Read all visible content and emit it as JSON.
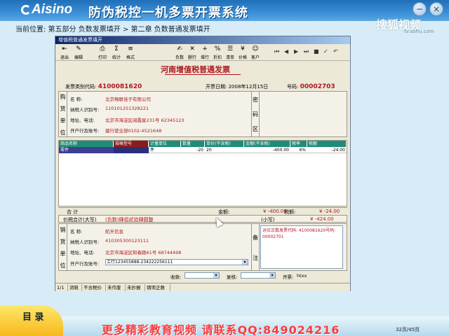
{
  "app": {
    "logo_text": "Aisino",
    "system_title": "防伪税控一机多票开票系统",
    "watermark": "搜狐视频",
    "watermark_url": "tv.sohu.com"
  },
  "breadcrumb": "当前位置: 第五部分  负数发票填开 > 第二章  负数普通发票填开",
  "window": {
    "title": "增值税普通发票填开",
    "toolbar": [
      {
        "name": "exit",
        "label": "退出",
        "icon": "⇤"
      },
      {
        "name": "edit",
        "label": "编辑",
        "icon": "✎"
      },
      {
        "name": "print",
        "label": "打印",
        "icon": "⎙"
      },
      {
        "name": "stats",
        "label": "统计",
        "icon": "Σ"
      },
      {
        "name": "format",
        "label": "格式",
        "icon": "≡"
      },
      {
        "name": "negative",
        "label": "负数",
        "icon": "✍"
      },
      {
        "name": "delete",
        "label": "删行",
        "icon": "✕"
      },
      {
        "name": "add",
        "label": "增行",
        "icon": "+"
      },
      {
        "name": "discount",
        "label": "折扣",
        "icon": "%"
      },
      {
        "name": "list",
        "label": "清单",
        "icon": "☰"
      },
      {
        "name": "taxprice",
        "label": "价格",
        "icon": "¥"
      },
      {
        "name": "customer",
        "label": "客户",
        "icon": "☺"
      }
    ],
    "nav": [
      "⏮",
      "◀",
      "▶",
      "⏭",
      "■",
      "✓",
      "↶"
    ],
    "invoice_title": "河南增值税普通发票",
    "invoice_code_label": "发票类别代码:",
    "invoice_code": "4100081620",
    "date_label": "开票日期:",
    "date": "2008年12月15日",
    "number_label": "号码:",
    "number": "00002703",
    "buyer": {
      "side_label": [
        "购",
        "货",
        "单",
        "位"
      ],
      "fields": [
        {
          "label": "名        称:",
          "value": "北京畅联佳子有限公司"
        },
        {
          "label": "纳税人识别号:",
          "value": "110101251328221"
        },
        {
          "label": "地址、电话:",
          "value": "北京市海淀区阅霞星231号 62345123"
        },
        {
          "label": "开户行及账号:",
          "value": "建行营业部0102-4521648"
        }
      ],
      "code_area_label": [
        "密",
        "码",
        "区"
      ]
    },
    "grid": {
      "columns": [
        "商品名称",
        "规格型号",
        "计量单位",
        "数量",
        "单价(不含税)",
        "金额(不含税)",
        "税率",
        "税额"
      ],
      "rows": [
        {
          "name": "零件",
          "spec": "",
          "unit": "件",
          "qty": "-20",
          "price": "20",
          "amount": "-400.00",
          "rate": "6%",
          "tax": "-24.00"
        }
      ]
    },
    "totals": {
      "label": "合        计",
      "amount_label": "金额:",
      "amount": "¥ -400.00",
      "tax_label": "税额:",
      "tax": "¥ -24.00"
    },
    "tax_total": {
      "label": "价税合计(大写)",
      "upper": "(负数)肆佰贰拾肆圆整",
      "small_label": "(小写)",
      "small": "¥ -424.00"
    },
    "seller": {
      "side_label": [
        "销",
        "货",
        "单",
        "位"
      ],
      "fields": [
        {
          "label": "名        称:",
          "value": "航天信息"
        },
        {
          "label": "纳税人识别号:",
          "value": "410305300123111"
        },
        {
          "label": "地址、电话:",
          "value": "北京市海淀区知春路61号 68744498"
        },
        {
          "label": "开户行及账号:",
          "value": "工行123455888-234222256111"
        }
      ],
      "remark_label": [
        "备",
        "注"
      ],
      "remark": "对应正数发票代码: 4100081620号码: 00002701"
    },
    "signatures": {
      "payee_label": "收款:",
      "review_label": "复核:",
      "issuer_label": "开票:",
      "issuer": "htxx"
    },
    "status_bar": [
      "1/1",
      "消筑",
      "不含税价",
      "未作废",
      "未抄报",
      "销项正数"
    ]
  },
  "bottom": {
    "menu_label": "目 录",
    "ad_text": "更多精彩教育视频   请联系QQ:849024216",
    "page_indicator": "32页/45页"
  }
}
